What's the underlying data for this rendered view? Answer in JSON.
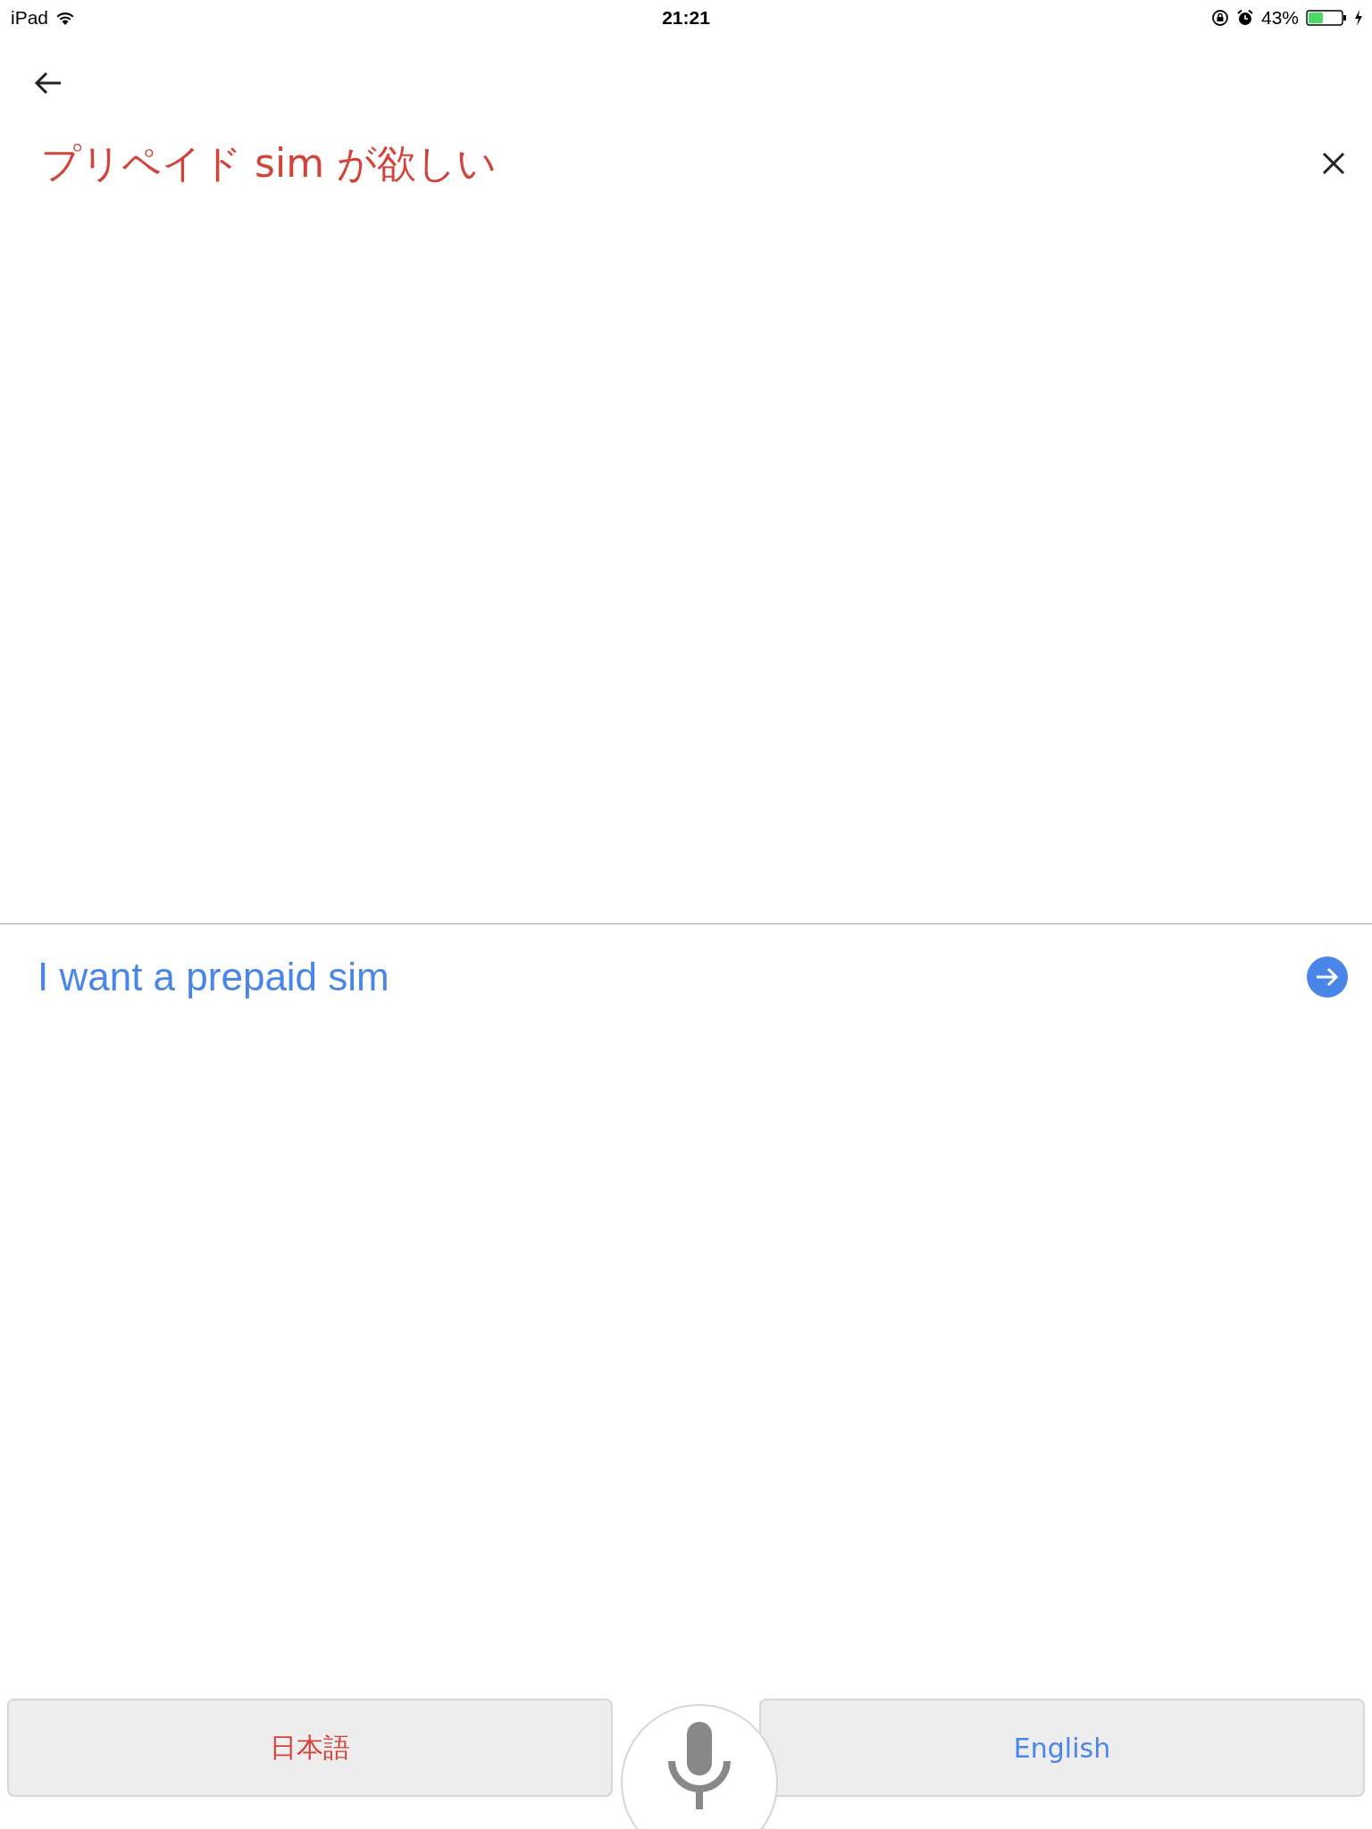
{
  "status_bar": {
    "device": "iPad",
    "time": "21:21",
    "battery": "43%"
  },
  "source": {
    "text": "プリペイド sim が欲しい"
  },
  "translation": {
    "text": "I want a prepaid sim"
  },
  "languages": [
    {
      "label": "日本語",
      "kind": "source"
    },
    {
      "label": "English",
      "kind": "target"
    }
  ]
}
